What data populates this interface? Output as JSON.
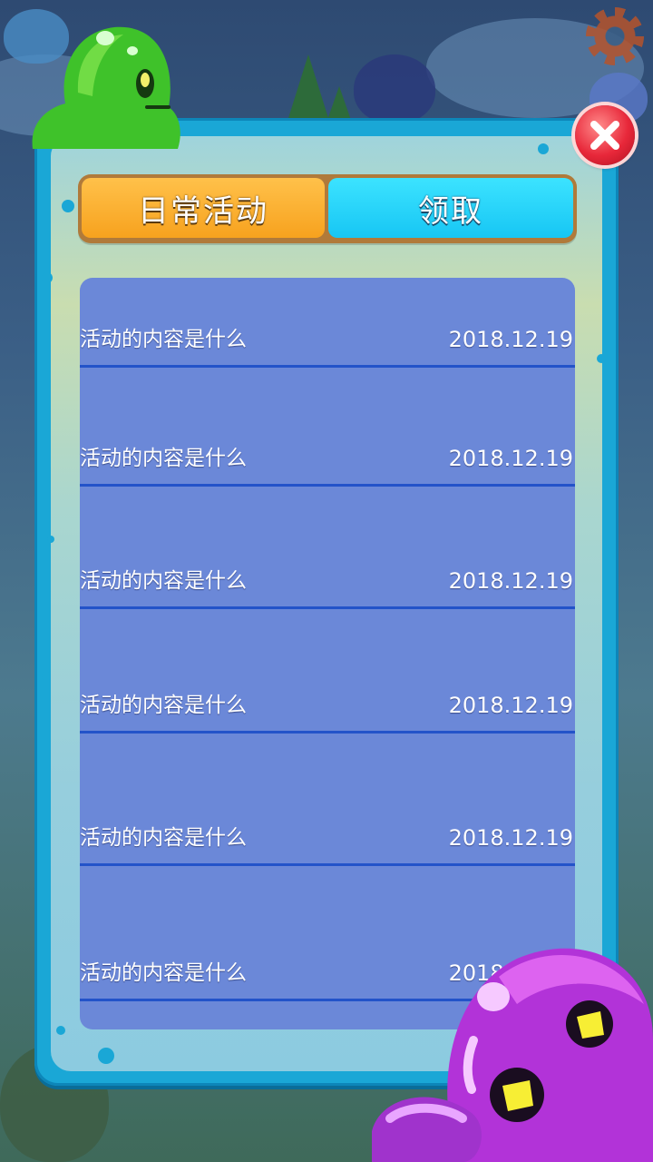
{
  "tabs": {
    "daily_label": "日常活动",
    "claim_label": "领取"
  },
  "activities": [
    {
      "title": "活动的内容是什么",
      "date": "2018.12.19"
    },
    {
      "title": "活动的内容是什么",
      "date": "2018.12.19"
    },
    {
      "title": "活动的内容是什么",
      "date": "2018.12.19"
    },
    {
      "title": "活动的内容是什么",
      "date": "2018.12.19"
    },
    {
      "title": "活动的内容是什么",
      "date": "2018.12.19"
    },
    {
      "title": "活动的内容是什么",
      "date": "2018.12.19"
    }
  ],
  "icons": {
    "close": "close-icon",
    "settings": "gear-icon"
  },
  "colors": {
    "daily_tab": "#f7a21e",
    "claim_tab": "#17c6f4",
    "list_bg": "#6b88d8",
    "row_divider": "#2353c9",
    "panel_border": "#1aa7d6",
    "close_button": "#e8283a"
  }
}
